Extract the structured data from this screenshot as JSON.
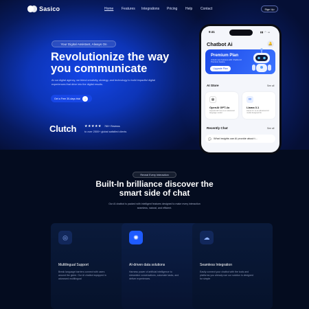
{
  "nav": {
    "brand": "Sasico",
    "items": [
      "Home",
      "Features",
      "Integrations",
      "Pricing",
      "Help",
      "Contact"
    ],
    "signup": "Sign Up"
  },
  "hero": {
    "pill": "Your Digital Assistant, Always On",
    "headline_line1": "Revolutionize the way",
    "headline_line2": "you communicate",
    "subtext": "At our digital agency, we blend creativity, strategy, and technology to build impactful digital experiences that drive into the digital results.",
    "cta": "Get a Free 30-days trial",
    "clutch": "Clutch",
    "stars": "★★★★★",
    "reviews": "780+ Reviews",
    "satisfied": "to over 2500+ global satisfied clients"
  },
  "phone": {
    "time": "9:41",
    "status": "▮▮ ◠ ▭",
    "title": "Chatbot Ai",
    "premium_title": "Premium Plan",
    "premium_sub": "Unlock new features with Chatbot AI Premium feature",
    "upgrade": "Upgrade Plan",
    "store_title": "AI Store",
    "see_all": "See all",
    "cards": [
      {
        "name": "OpenAI GPT-4o",
        "desc": "OpenAI GPT-4o is an advanced language model"
      },
      {
        "name": "Llama 3.1",
        "desc": "Llama 3.1 is an advanced AI model designed for"
      }
    ],
    "recent_title": "Recently Chat",
    "recent_see_all": "See all",
    "chat_text": "What insights can AI provide about t..."
  },
  "section": {
    "pill": "Reveal Every Interaction",
    "heading_line1": "Built-In brilliance discover the",
    "heading_line2": "smart side of chat",
    "desc": "Our AI chatbot is packed with intelligent features designed to make every interaction seamless, natural, and efficient."
  },
  "features": [
    {
      "title": "Multilingual Support",
      "desc": "Break language barriers connect with users around the globe. Our AI chatbot equipped in advanced multilingual",
      "icon": "globe-chat-icon"
    },
    {
      "title": "AI-driven data solutions",
      "desc": "Harness power of artificial intelligence to streamline conversations, automate tasks, and deliver experiences.",
      "icon": "chip-icon"
    },
    {
      "title": "Seamless Integration",
      "desc": "Easily connect your chatbot with the tools and platforms you already use our solution is designed for simple",
      "icon": "integration-icon"
    }
  ],
  "colors": {
    "accent": "#1746e6",
    "background": "#040c1f",
    "hero_glow": "#1446e8"
  }
}
